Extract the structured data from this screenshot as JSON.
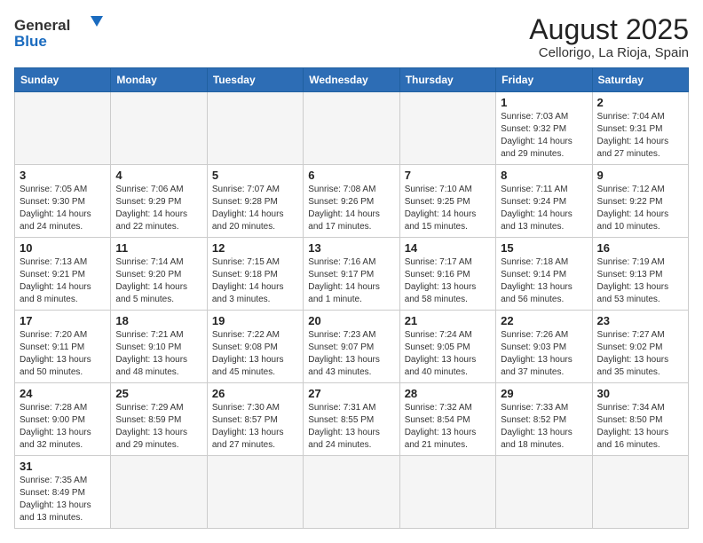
{
  "header": {
    "logo_general": "General",
    "logo_blue": "Blue",
    "month_title": "August 2025",
    "location": "Cellorigo, La Rioja, Spain"
  },
  "weekdays": [
    "Sunday",
    "Monday",
    "Tuesday",
    "Wednesday",
    "Thursday",
    "Friday",
    "Saturday"
  ],
  "weeks": [
    [
      {
        "day": "",
        "info": ""
      },
      {
        "day": "",
        "info": ""
      },
      {
        "day": "",
        "info": ""
      },
      {
        "day": "",
        "info": ""
      },
      {
        "day": "",
        "info": ""
      },
      {
        "day": "1",
        "info": "Sunrise: 7:03 AM\nSunset: 9:32 PM\nDaylight: 14 hours and 29 minutes."
      },
      {
        "day": "2",
        "info": "Sunrise: 7:04 AM\nSunset: 9:31 PM\nDaylight: 14 hours and 27 minutes."
      }
    ],
    [
      {
        "day": "3",
        "info": "Sunrise: 7:05 AM\nSunset: 9:30 PM\nDaylight: 14 hours and 24 minutes."
      },
      {
        "day": "4",
        "info": "Sunrise: 7:06 AM\nSunset: 9:29 PM\nDaylight: 14 hours and 22 minutes."
      },
      {
        "day": "5",
        "info": "Sunrise: 7:07 AM\nSunset: 9:28 PM\nDaylight: 14 hours and 20 minutes."
      },
      {
        "day": "6",
        "info": "Sunrise: 7:08 AM\nSunset: 9:26 PM\nDaylight: 14 hours and 17 minutes."
      },
      {
        "day": "7",
        "info": "Sunrise: 7:10 AM\nSunset: 9:25 PM\nDaylight: 14 hours and 15 minutes."
      },
      {
        "day": "8",
        "info": "Sunrise: 7:11 AM\nSunset: 9:24 PM\nDaylight: 14 hours and 13 minutes."
      },
      {
        "day": "9",
        "info": "Sunrise: 7:12 AM\nSunset: 9:22 PM\nDaylight: 14 hours and 10 minutes."
      }
    ],
    [
      {
        "day": "10",
        "info": "Sunrise: 7:13 AM\nSunset: 9:21 PM\nDaylight: 14 hours and 8 minutes."
      },
      {
        "day": "11",
        "info": "Sunrise: 7:14 AM\nSunset: 9:20 PM\nDaylight: 14 hours and 5 minutes."
      },
      {
        "day": "12",
        "info": "Sunrise: 7:15 AM\nSunset: 9:18 PM\nDaylight: 14 hours and 3 minutes."
      },
      {
        "day": "13",
        "info": "Sunrise: 7:16 AM\nSunset: 9:17 PM\nDaylight: 14 hours and 1 minute."
      },
      {
        "day": "14",
        "info": "Sunrise: 7:17 AM\nSunset: 9:16 PM\nDaylight: 13 hours and 58 minutes."
      },
      {
        "day": "15",
        "info": "Sunrise: 7:18 AM\nSunset: 9:14 PM\nDaylight: 13 hours and 56 minutes."
      },
      {
        "day": "16",
        "info": "Sunrise: 7:19 AM\nSunset: 9:13 PM\nDaylight: 13 hours and 53 minutes."
      }
    ],
    [
      {
        "day": "17",
        "info": "Sunrise: 7:20 AM\nSunset: 9:11 PM\nDaylight: 13 hours and 50 minutes."
      },
      {
        "day": "18",
        "info": "Sunrise: 7:21 AM\nSunset: 9:10 PM\nDaylight: 13 hours and 48 minutes."
      },
      {
        "day": "19",
        "info": "Sunrise: 7:22 AM\nSunset: 9:08 PM\nDaylight: 13 hours and 45 minutes."
      },
      {
        "day": "20",
        "info": "Sunrise: 7:23 AM\nSunset: 9:07 PM\nDaylight: 13 hours and 43 minutes."
      },
      {
        "day": "21",
        "info": "Sunrise: 7:24 AM\nSunset: 9:05 PM\nDaylight: 13 hours and 40 minutes."
      },
      {
        "day": "22",
        "info": "Sunrise: 7:26 AM\nSunset: 9:03 PM\nDaylight: 13 hours and 37 minutes."
      },
      {
        "day": "23",
        "info": "Sunrise: 7:27 AM\nSunset: 9:02 PM\nDaylight: 13 hours and 35 minutes."
      }
    ],
    [
      {
        "day": "24",
        "info": "Sunrise: 7:28 AM\nSunset: 9:00 PM\nDaylight: 13 hours and 32 minutes."
      },
      {
        "day": "25",
        "info": "Sunrise: 7:29 AM\nSunset: 8:59 PM\nDaylight: 13 hours and 29 minutes."
      },
      {
        "day": "26",
        "info": "Sunrise: 7:30 AM\nSunset: 8:57 PM\nDaylight: 13 hours and 27 minutes."
      },
      {
        "day": "27",
        "info": "Sunrise: 7:31 AM\nSunset: 8:55 PM\nDaylight: 13 hours and 24 minutes."
      },
      {
        "day": "28",
        "info": "Sunrise: 7:32 AM\nSunset: 8:54 PM\nDaylight: 13 hours and 21 minutes."
      },
      {
        "day": "29",
        "info": "Sunrise: 7:33 AM\nSunset: 8:52 PM\nDaylight: 13 hours and 18 minutes."
      },
      {
        "day": "30",
        "info": "Sunrise: 7:34 AM\nSunset: 8:50 PM\nDaylight: 13 hours and 16 minutes."
      }
    ],
    [
      {
        "day": "31",
        "info": "Sunrise: 7:35 AM\nSunset: 8:49 PM\nDaylight: 13 hours and 13 minutes."
      },
      {
        "day": "",
        "info": ""
      },
      {
        "day": "",
        "info": ""
      },
      {
        "day": "",
        "info": ""
      },
      {
        "day": "",
        "info": ""
      },
      {
        "day": "",
        "info": ""
      },
      {
        "day": "",
        "info": ""
      }
    ]
  ]
}
